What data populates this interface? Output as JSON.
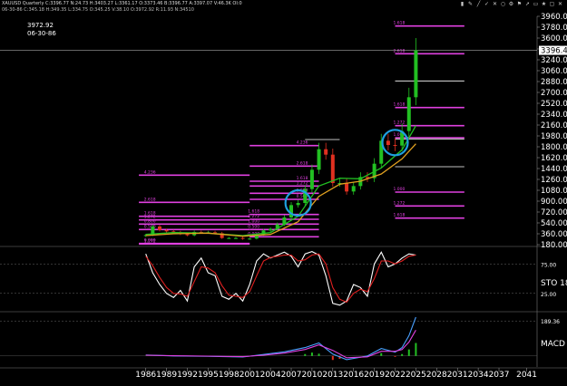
{
  "header": {
    "line1": "XAUUSD  Quarterly  C:3396.77  N:24.73  H:3403.27  L:3361.17  O:3373.46  B:3396.77  A:3397.07  V:46.3K  OI:0",
    "line2": "06-30-86   C:345.18   H:349.35   L:334.75   O:345.25   V:38.10   O:3972.92   R:11.93   N:34510",
    "cursor_value": "3972.92",
    "cursor_date": "06-30-86"
  },
  "toolbar_icons": [
    "bar-chart-icon",
    "pencil-icon",
    "line-icon",
    "check-icon",
    "cross-icon",
    "circle-icon",
    "gear-icon",
    "flag-icon",
    "arrow-icon",
    "folder-icon",
    "star-icon",
    "window-icon",
    "close-icon"
  ],
  "colors": {
    "background": "#000000",
    "up_candle": "#22c022",
    "down_candle": "#e03020",
    "fib": "#e040e0",
    "stoch_k": "#ffffff",
    "stoch_d": "#e02020",
    "macd": "#4aa0ff",
    "signal": "#e040e0",
    "circle": "#1ea0e0"
  },
  "chart_data": [
    {
      "type": "candlestick",
      "name": "price",
      "y_scale": "linear",
      "ylim": [
        180,
        3960
      ],
      "x_ticks": [
        "1986",
        "1989",
        "1992",
        "1995",
        "1998",
        "2001",
        "2004",
        "2007",
        "2010",
        "2013",
        "2016",
        "2019",
        "2022",
        "2025",
        "2028",
        "2031",
        "2034",
        "2037",
        "2041"
      ],
      "x_tick_years": [
        1986,
        1989,
        1992,
        1995,
        1998,
        2001,
        2004,
        2007,
        2010,
        2013,
        2016,
        2019,
        2022,
        2025,
        2028,
        2031,
        2034,
        2037,
        2041
      ],
      "xlim": [
        1982.5,
        2042.5
      ],
      "y_ticks": [
        180,
        360,
        540,
        720,
        900,
        1080,
        1260,
        1440,
        1620,
        1800,
        1980,
        2160,
        2340,
        2520,
        2700,
        2880,
        3060,
        3240,
        3420,
        3600,
        3780,
        3960
      ],
      "y_tick_labels": [
        "180.00",
        "360.00",
        "540.00",
        "720.00",
        "900.00",
        "1080.00",
        "1260.00",
        "1440.00",
        "1620.00",
        "1800.00",
        "1980.00",
        "2160.00",
        "2340.00",
        "2520.00",
        "2700.00",
        "2880.00",
        "3060.00",
        "3240.00",
        "3420.00",
        "3600.00",
        "3780.00",
        "3960.00"
      ],
      "last_price_label": "3396.46",
      "last_price": 3396.46,
      "close_series": [
        {
          "year": 1986,
          "close": 340
        },
        {
          "year": 1987,
          "close": 480
        },
        {
          "year": 1988,
          "close": 420
        },
        {
          "year": 1989,
          "close": 400
        },
        {
          "year": 1990,
          "close": 385
        },
        {
          "year": 1991,
          "close": 355
        },
        {
          "year": 1992,
          "close": 335
        },
        {
          "year": 1993,
          "close": 390
        },
        {
          "year": 1994,
          "close": 380
        },
        {
          "year": 1995,
          "close": 385
        },
        {
          "year": 1996,
          "close": 370
        },
        {
          "year": 1997,
          "close": 290
        },
        {
          "year": 1998,
          "close": 290
        },
        {
          "year": 1999,
          "close": 290
        },
        {
          "year": 2000,
          "close": 275
        },
        {
          "year": 2001,
          "close": 280
        },
        {
          "year": 2002,
          "close": 345
        },
        {
          "year": 2003,
          "close": 415
        },
        {
          "year": 2004,
          "close": 440
        },
        {
          "year": 2005,
          "close": 515
        },
        {
          "year": 2006,
          "close": 630
        },
        {
          "year": 2007,
          "close": 835
        },
        {
          "year": 2008,
          "close": 870
        },
        {
          "year": 2009,
          "close": 1100
        },
        {
          "year": 2010,
          "close": 1420
        },
        {
          "year": 2011,
          "close": 1760
        },
        {
          "year": 2012,
          "close": 1670
        },
        {
          "year": 2013,
          "close": 1200
        },
        {
          "year": 2014,
          "close": 1200
        },
        {
          "year": 2015,
          "close": 1060
        },
        {
          "year": 2016,
          "close": 1150
        },
        {
          "year": 2017,
          "close": 1300
        },
        {
          "year": 2018,
          "close": 1280
        },
        {
          "year": 2019,
          "close": 1520
        },
        {
          "year": 2020,
          "close": 1900
        },
        {
          "year": 2021,
          "close": 1830
        },
        {
          "year": 2022,
          "close": 1820
        },
        {
          "year": 2023,
          "close": 2060
        },
        {
          "year": 2024,
          "close": 2620
        },
        {
          "year": 2025,
          "close": 3396
        }
      ],
      "moving_averages": [
        {
          "color": "#22c022",
          "points": [
            [
              1986,
              350
            ],
            [
              1990,
              380
            ],
            [
              1995,
              370
            ],
            [
              2000,
              330
            ],
            [
              2004,
              380
            ],
            [
              2008,
              650
            ],
            [
              2011,
              1150
            ],
            [
              2014,
              1280
            ],
            [
              2017,
              1270
            ],
            [
              2020,
              1450
            ],
            [
              2023,
              1750
            ],
            [
              2025,
              2150
            ]
          ]
        },
        {
          "color": "#e0a020",
          "points": [
            [
              1986,
              330
            ],
            [
              1990,
              360
            ],
            [
              1995,
              370
            ],
            [
              2000,
              320
            ],
            [
              2004,
              350
            ],
            [
              2008,
              560
            ],
            [
              2011,
              980
            ],
            [
              2014,
              1180
            ],
            [
              2017,
              1230
            ],
            [
              2020,
              1350
            ],
            [
              2023,
              1600
            ],
            [
              2025,
              1850
            ]
          ]
        }
      ],
      "fib_sets": [
        {
          "x_start": 2001,
          "x_end": 2011,
          "x_start_label": 2008,
          "levels": [
            {
              "label": "4.236",
              "value": 1820
            },
            {
              "label": "2.618",
              "value": 1480
            },
            {
              "label": "1.618",
              "value": 1230
            },
            {
              "label": "1.272",
              "value": 1150
            },
            {
              "label": "1.000",
              "value": 1030
            },
            {
              "label": "0.500",
              "value": 930
            }
          ]
        },
        {
          "x_start": 2001,
          "x_end": 2011,
          "x_start_label": 2001,
          "levels": [
            {
              "label": "1.618",
              "value": 680
            },
            {
              "label": "1.272",
              "value": 600
            },
            {
              "label": "1.000",
              "value": 520
            },
            {
              "label": "0.500",
              "value": 430
            },
            {
              "label": "0.000",
              "value": 310
            }
          ]
        },
        {
          "x_start": 1985,
          "x_end": 2001,
          "x_start_label": 1986,
          "levels": [
            {
              "label": "4.236",
              "value": 1330
            },
            {
              "label": "2.618",
              "value": 880
            },
            {
              "label": "1.618",
              "value": 650
            },
            {
              "label": "1.272",
              "value": 590
            },
            {
              "label": "0.800",
              "value": 520
            },
            {
              "label": "0.500",
              "value": 430
            },
            {
              "label": "0.000",
              "value": 200
            },
            {
              "label": "1.272",
              "value": 190
            }
          ]
        },
        {
          "x_start": 2022,
          "x_end": 2032,
          "x_start_label": 2022,
          "levels": [
            {
              "label": "1.618",
              "value": 3800
            },
            {
              "label": "2.618",
              "value": 3340
            },
            {
              "label": "1.618",
              "value": 2450
            },
            {
              "label": "1.272",
              "value": 2150
            },
            {
              "label": "1.000",
              "value": 1950
            },
            {
              "label": "1.000",
              "value": 1050
            },
            {
              "label": "1.272",
              "value": 820
            },
            {
              "label": "1.618",
              "value": 620
            }
          ]
        }
      ],
      "reference_lines": [
        {
          "x_start": 2009,
          "x_end": 2014,
          "value": 1920,
          "color": "#ffffff"
        },
        {
          "x_start": 2022,
          "x_end": 2032,
          "value": 1930,
          "color": "#ffffff"
        },
        {
          "x_start": 2022,
          "x_end": 2032,
          "value": 2890,
          "color": "#ffffff"
        },
        {
          "x_start": 2022,
          "x_end": 2032,
          "value": 1470,
          "color": "#ffffff"
        }
      ],
      "circles": [
        {
          "year": 2008,
          "value": 870
        },
        {
          "year": 2022,
          "value": 1870
        }
      ]
    },
    {
      "type": "line",
      "name": "STO 18",
      "label": "STO  18",
      "ylim": [
        0,
        100
      ],
      "y_ticks_labels": [
        "75.00",
        "25.00"
      ],
      "y_ticks": [
        75,
        25
      ],
      "series": [
        {
          "color": "#ffffff",
          "points": [
            [
              1986,
              92
            ],
            [
              1987,
              60
            ],
            [
              1988,
              40
            ],
            [
              1989,
              25
            ],
            [
              1990,
              18
            ],
            [
              1991,
              30
            ],
            [
              1992,
              12
            ],
            [
              1993,
              70
            ],
            [
              1994,
              85
            ],
            [
              1995,
              60
            ],
            [
              1996,
              55
            ],
            [
              1997,
              20
            ],
            [
              1998,
              15
            ],
            [
              1999,
              25
            ],
            [
              2000,
              12
            ],
            [
              2001,
              40
            ],
            [
              2002,
              80
            ],
            [
              2003,
              92
            ],
            [
              2004,
              85
            ],
            [
              2005,
              90
            ],
            [
              2006,
              95
            ],
            [
              2007,
              88
            ],
            [
              2008,
              70
            ],
            [
              2009,
              92
            ],
            [
              2010,
              96
            ],
            [
              2011,
              90
            ],
            [
              2012,
              55
            ],
            [
              2013,
              8
            ],
            [
              2014,
              5
            ],
            [
              2015,
              12
            ],
            [
              2016,
              40
            ],
            [
              2017,
              35
            ],
            [
              2018,
              20
            ],
            [
              2019,
              75
            ],
            [
              2020,
              95
            ],
            [
              2021,
              70
            ],
            [
              2022,
              75
            ],
            [
              2023,
              85
            ],
            [
              2024,
              92
            ],
            [
              2025,
              90
            ]
          ]
        },
        {
          "color": "#e02020",
          "points": [
            [
              1986,
              88
            ],
            [
              1987,
              72
            ],
            [
              1988,
              52
            ],
            [
              1989,
              35
            ],
            [
              1990,
              25
            ],
            [
              1991,
              24
            ],
            [
              1992,
              20
            ],
            [
              1993,
              45
            ],
            [
              1994,
              70
            ],
            [
              1995,
              68
            ],
            [
              1996,
              60
            ],
            [
              1997,
              38
            ],
            [
              1998,
              22
            ],
            [
              1999,
              20
            ],
            [
              2000,
              18
            ],
            [
              2001,
              28
            ],
            [
              2002,
              55
            ],
            [
              2003,
              80
            ],
            [
              2004,
              86
            ],
            [
              2005,
              88
            ],
            [
              2006,
              90
            ],
            [
              2007,
              90
            ],
            [
              2008,
              80
            ],
            [
              2009,
              82
            ],
            [
              2010,
              90
            ],
            [
              2011,
              92
            ],
            [
              2012,
              75
            ],
            [
              2013,
              35
            ],
            [
              2014,
              15
            ],
            [
              2015,
              10
            ],
            [
              2016,
              25
            ],
            [
              2017,
              32
            ],
            [
              2018,
              28
            ],
            [
              2019,
              50
            ],
            [
              2020,
              80
            ],
            [
              2021,
              80
            ],
            [
              2022,
              75
            ],
            [
              2023,
              80
            ],
            [
              2024,
              88
            ],
            [
              2025,
              90
            ]
          ]
        }
      ]
    },
    {
      "type": "line",
      "name": "MACD 6",
      "label": "MACD  6",
      "ylim": [
        -60,
        220
      ],
      "y_ticks_labels": [
        "189.36"
      ],
      "y_ticks": [
        189.36
      ],
      "series": [
        {
          "color": "#4aa0ff",
          "points": [
            [
              1986,
              5
            ],
            [
              1990,
              0
            ],
            [
              1995,
              -2
            ],
            [
              2000,
              -6
            ],
            [
              2003,
              8
            ],
            [
              2006,
              22
            ],
            [
              2009,
              45
            ],
            [
              2011,
              70
            ],
            [
              2013,
              10
            ],
            [
              2015,
              -20
            ],
            [
              2018,
              0
            ],
            [
              2020,
              40
            ],
            [
              2022,
              20
            ],
            [
              2023,
              45
            ],
            [
              2024,
              110
            ],
            [
              2025,
              210
            ]
          ]
        },
        {
          "color": "#e040e0",
          "points": [
            [
              1986,
              4
            ],
            [
              1990,
              1
            ],
            [
              1995,
              -1
            ],
            [
              2000,
              -4
            ],
            [
              2003,
              4
            ],
            [
              2006,
              15
            ],
            [
              2009,
              35
            ],
            [
              2011,
              60
            ],
            [
              2013,
              30
            ],
            [
              2015,
              -10
            ],
            [
              2018,
              -5
            ],
            [
              2020,
              25
            ],
            [
              2022,
              25
            ],
            [
              2023,
              35
            ],
            [
              2024,
              75
            ],
            [
              2025,
              140
            ]
          ]
        }
      ],
      "histogram": [
        {
          "year": 2009,
          "value": 10
        },
        {
          "year": 2010,
          "value": 18
        },
        {
          "year": 2011,
          "value": 12
        },
        {
          "year": 2013,
          "value": -22
        },
        {
          "year": 2014,
          "value": -16
        },
        {
          "year": 2020,
          "value": 15
        },
        {
          "year": 2022,
          "value": -5
        },
        {
          "year": 2023,
          "value": 10
        },
        {
          "year": 2024,
          "value": 35
        },
        {
          "year": 2025,
          "value": 70
        }
      ]
    }
  ]
}
